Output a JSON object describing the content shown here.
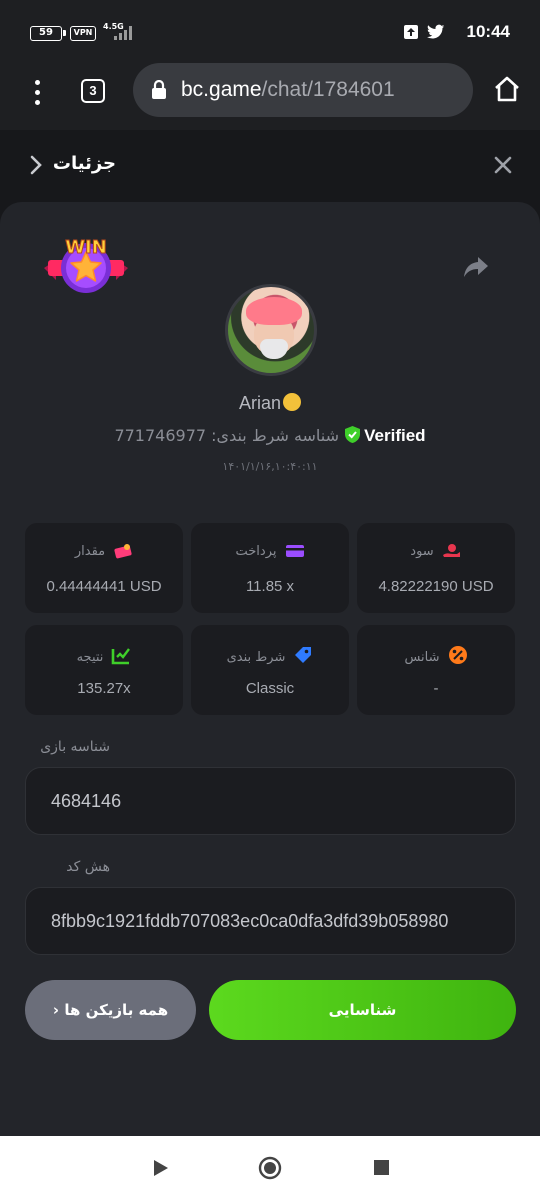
{
  "status_bar": {
    "battery": "59",
    "vpn": "VPN",
    "network": "4.5G",
    "time": "10:44",
    "icons": [
      "upload-icon",
      "twitter-icon"
    ]
  },
  "browser": {
    "tab_count": "3",
    "url_host": "bc.game",
    "url_path": "/chat/1784601"
  },
  "header": {
    "title": "جزئیات"
  },
  "bet": {
    "username": "Arian",
    "verified_label": "Verified",
    "bet_id_text": "شناسه شرط بندی: 771746977",
    "date": "۱۴۰۱/۱/۱۶,۱۰:۴۰:۱۱",
    "badge": "WIN"
  },
  "stats": [
    {
      "label": "سود",
      "value": "4.82222190 USD",
      "icon": "profit-icon",
      "color": "#e8364e"
    },
    {
      "label": "پرداخت",
      "value": "11.85 x",
      "icon": "payment-card-icon",
      "color": "#9b4dff"
    },
    {
      "label": "مقدار",
      "value": "0.44444441 USD",
      "icon": "amount-icon",
      "color": "#ff3c7a"
    },
    {
      "label": "شانس",
      "value": "-",
      "icon": "percent-icon",
      "color": "#ff7a1a"
    },
    {
      "label": "شرط بندی",
      "value": "Classic",
      "icon": "bet-tag-icon",
      "color": "#2f7bff"
    },
    {
      "label": "نتیجه",
      "value": "135.27x",
      "icon": "result-icon",
      "color": "#3fcf2a"
    }
  ],
  "fields": {
    "game_id_label": "شناسه بازی",
    "game_id_value": "4684146",
    "hash_label": "هش کد",
    "hash_value": "8fbb9c1921fddb707083ec0ca0dfa3dfd39b058980"
  },
  "buttons": {
    "all_players": "همه بازیکن ها",
    "verify": "شناسایی"
  }
}
